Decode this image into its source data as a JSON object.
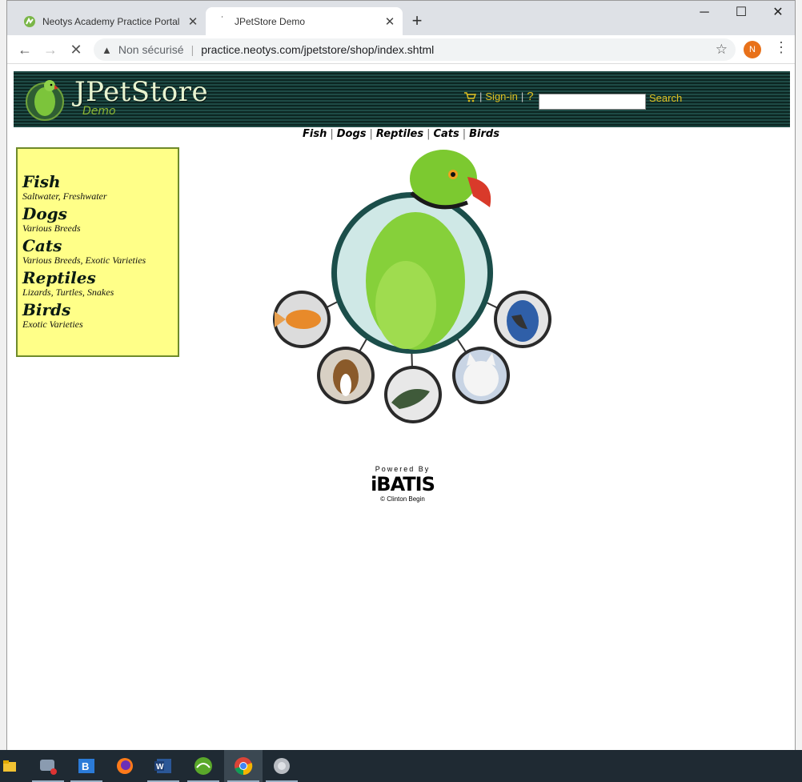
{
  "browser": {
    "tabs": [
      {
        "title": "Neotys Academy Practice Portal",
        "active": false
      },
      {
        "title": "JPetStore Demo",
        "active": true
      }
    ],
    "new_tab": "+",
    "window_controls": {
      "minimize": "─",
      "maximize": "☐",
      "close": "✕"
    },
    "nav": {
      "back": "←",
      "forward": "→",
      "reload": "✕"
    },
    "address": {
      "security_label": "Non sécurisé",
      "separator": "|",
      "url": "practice.neotys.com/jpetstore/shop/index.shtml"
    },
    "profile_initial": "N",
    "menu": "⋮"
  },
  "header": {
    "logo_title": "JPetStore",
    "logo_subtitle": "Demo",
    "signin_label": "Sign-in",
    "help_label": "?",
    "separator": "|",
    "search_value": "",
    "search_button": "Search"
  },
  "quicklinks": [
    "Fish",
    "Dogs",
    "Reptiles",
    "Cats",
    "Birds"
  ],
  "quicklink_separator": "|",
  "sidebar": {
    "categories": [
      {
        "name": "Fish",
        "desc": "Saltwater, Freshwater"
      },
      {
        "name": "Dogs",
        "desc": "Various Breeds"
      },
      {
        "name": "Cats",
        "desc": "Various Breeds, Exotic Varieties"
      },
      {
        "name": "Reptiles",
        "desc": "Lizards, Turtles, Snakes"
      },
      {
        "name": "Birds",
        "desc": "Exotic Varieties"
      }
    ]
  },
  "footer": {
    "powered_by": "Powered By",
    "brand": "iBATIS",
    "copyright": "© Clinton Begin"
  },
  "taskbar": {
    "apps": [
      "file-explorer",
      "app-with-badge",
      "app-b",
      "firefox",
      "word",
      "app-green",
      "chrome",
      "app-gray"
    ],
    "active_app": "chrome"
  },
  "colors": {
    "header_stripe_dark": "#0c2622",
    "header_stripe_light": "#1e4a45",
    "link_yellow": "#e0c020",
    "sidebar_bg": "#ffff88",
    "sidebar_border": "#6e8a2a",
    "taskbar_bg": "#1f2a33"
  }
}
